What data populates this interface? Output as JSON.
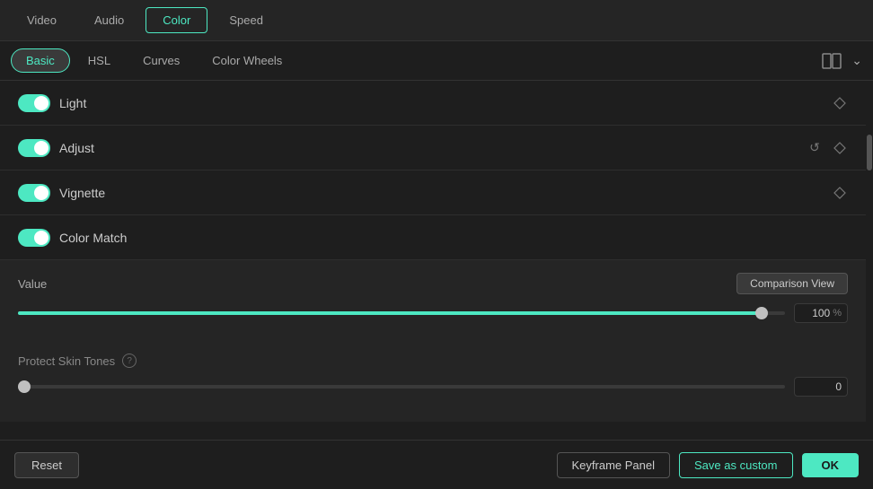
{
  "topTabs": [
    {
      "label": "Video",
      "active": false
    },
    {
      "label": "Audio",
      "active": false
    },
    {
      "label": "Color",
      "active": true
    },
    {
      "label": "Speed",
      "active": false
    }
  ],
  "subTabs": [
    {
      "label": "Basic",
      "active": true
    },
    {
      "label": "HSL",
      "active": false
    },
    {
      "label": "Curves",
      "active": false
    },
    {
      "label": "Color Wheels",
      "active": false
    }
  ],
  "sections": [
    {
      "id": "light",
      "label": "Light",
      "toggleOn": true,
      "hasReset": false,
      "hasDiamond": true
    },
    {
      "id": "adjust",
      "label": "Adjust",
      "toggleOn": true,
      "hasReset": true,
      "hasDiamond": true
    },
    {
      "id": "vignette",
      "label": "Vignette",
      "toggleOn": true,
      "hasReset": false,
      "hasDiamond": true
    },
    {
      "id": "color-match",
      "label": "Color Match",
      "toggleOn": true,
      "hasReset": false,
      "hasDiamond": false
    }
  ],
  "valueSection": {
    "label": "Value",
    "comparisonViewLabel": "Comparison View",
    "sliderValue": "100",
    "sliderUnit": "%",
    "sliderPercent": 97
  },
  "protectSection": {
    "label": "Protect Skin Tones",
    "sliderValue": "0",
    "sliderPercent": 0
  },
  "footer": {
    "resetLabel": "Reset",
    "keyframeLabel": "Keyframe Panel",
    "saveCustomLabel": "Save as custom",
    "okLabel": "OK"
  }
}
